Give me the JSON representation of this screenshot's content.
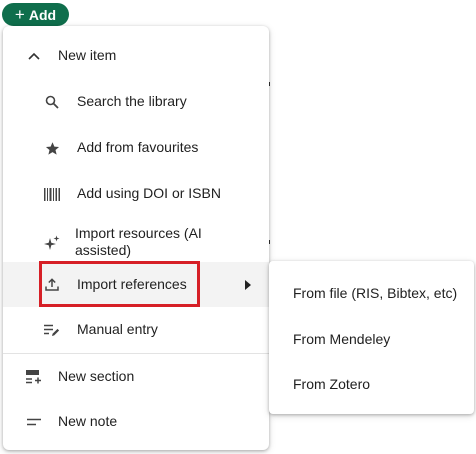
{
  "add_button": {
    "label": "Add",
    "icon": "plus-icon",
    "color": "#0f6e4c"
  },
  "menu": {
    "new_item": {
      "label": "New item",
      "icon": "chevron-up-icon"
    },
    "sub_items": [
      {
        "label": "Search the library",
        "icon": "search-icon"
      },
      {
        "label": "Add from favourites",
        "icon": "star-icon"
      },
      {
        "label": "Add using DOI or ISBN",
        "icon": "barcode-icon"
      },
      {
        "label": "Import resources (AI",
        "label2": "assisted)",
        "icon": "sparkle-icon"
      },
      {
        "label": "Import references",
        "icon": "upload-icon"
      },
      {
        "label": "Manual entry",
        "icon": "edit-list-icon"
      }
    ],
    "new_section": {
      "label": "New section",
      "icon": "section-icon"
    },
    "new_note": {
      "label": "New note",
      "icon": "note-icon"
    }
  },
  "submenu": {
    "items": [
      {
        "label": "From file (RIS, Bibtex, etc)"
      },
      {
        "label": "From Mendeley"
      },
      {
        "label": "From Zotero"
      }
    ]
  },
  "highlight_color": "#d61f26"
}
